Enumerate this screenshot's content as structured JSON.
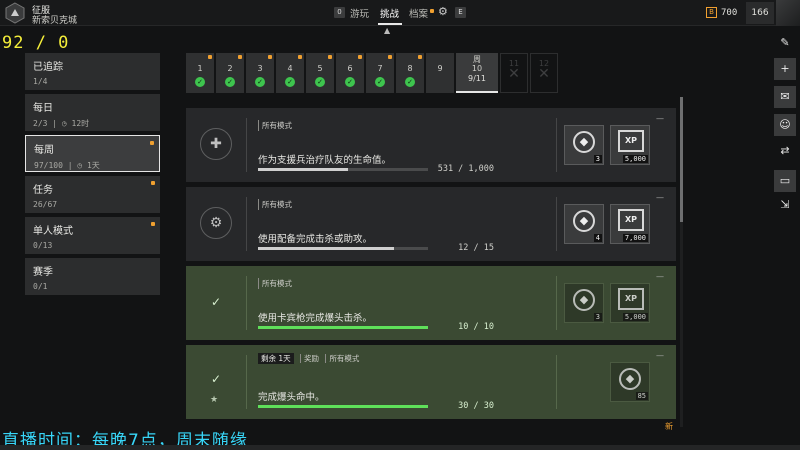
{
  "header": {
    "mode_title": "征服",
    "mode_subtitle": "新索贝克城",
    "key_left": "0",
    "tabs": [
      {
        "label": "游玩"
      },
      {
        "label": "挑战"
      },
      {
        "label": "档案"
      }
    ],
    "key_right": "E",
    "currency_icon": "B",
    "currency": "700",
    "level": "166"
  },
  "overlay_counter": "92 / 0",
  "sidebar": {
    "items": [
      {
        "title": "已追踪",
        "sub": "1/4"
      },
      {
        "title": "每日",
        "sub": "2/3 | ◷ 12时"
      },
      {
        "title": "每周",
        "sub": "97/100 | ◷ 1天"
      },
      {
        "title": "任务",
        "sub": "26/67"
      },
      {
        "title": "单人模式",
        "sub": "0/13"
      },
      {
        "title": "赛季",
        "sub": "0/1"
      }
    ]
  },
  "days": {
    "items": [
      "1",
      "2",
      "3",
      "4",
      "5",
      "6",
      "7",
      "8",
      "9"
    ],
    "current_label": "周",
    "current_num": "10",
    "current_progress": "9/11",
    "locked": [
      "11",
      "12"
    ]
  },
  "cards": [
    {
      "tag": "所有模式",
      "desc": "作为支援兵治疗队友的生命值。",
      "progress": "531 / 1,000",
      "progress_fraction": 0.531,
      "rewards": [
        {
          "qty": "3"
        },
        {
          "qty": "5,000",
          "label": "XP"
        }
      ]
    },
    {
      "tag": "所有模式",
      "desc": "使用配备完成击杀或助攻。",
      "progress": "12 / 15",
      "progress_fraction": 0.8,
      "rewards": [
        {
          "qty": "4"
        },
        {
          "qty": "7,000",
          "label": "XP"
        }
      ]
    },
    {
      "tag": "所有模式",
      "desc": "使用卡宾枪完成爆头击杀。",
      "progress": "10 / 10",
      "progress_fraction": 1.0,
      "rewards": [
        {
          "qty": "3"
        },
        {
          "qty": "5,000",
          "label": "XP"
        }
      ]
    },
    {
      "tags": [
        "剩余 1天",
        "奖励",
        "所有模式"
      ],
      "desc": "完成爆头命中。",
      "progress": "30 / 30",
      "progress_fraction": 1.0,
      "rewards": [
        {
          "qty": "85"
        }
      ]
    }
  ],
  "new_tag": "新",
  "stream_text": "直播时间：每晚7点，周末随缘",
  "colors": {
    "accent_green": "#5fe05a",
    "orange": "#f0a030",
    "done_bg": "#3b4a33"
  }
}
